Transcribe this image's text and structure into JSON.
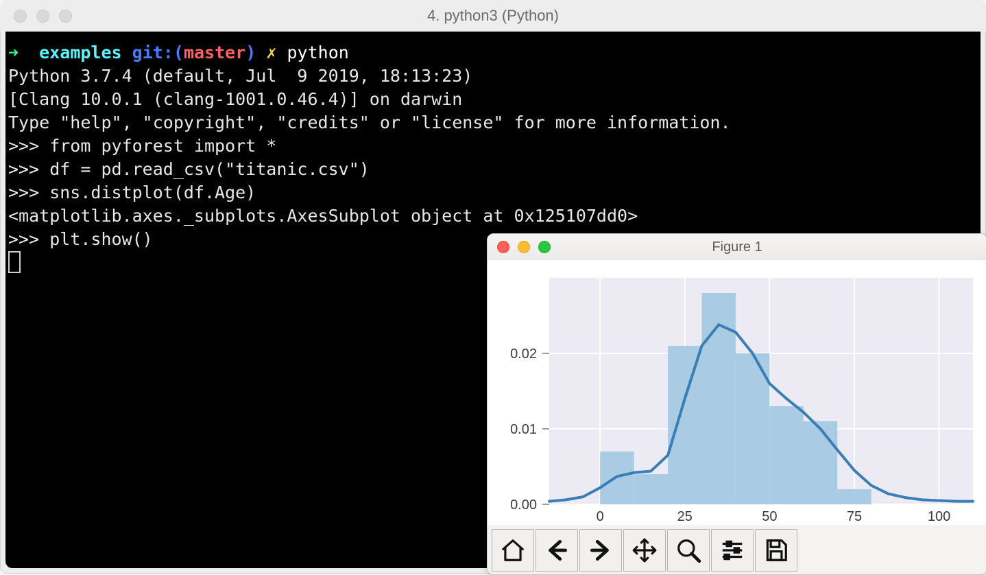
{
  "terminal": {
    "title": "4. python3 (Python)",
    "prompt": {
      "arrow": "➜",
      "dir": "examples",
      "git_label": "git:",
      "lparen": "(",
      "branch": "master",
      "rparen": ")",
      "dirty": "✗",
      "cmd": "python"
    },
    "lines": {
      "ver": "Python 3.7.4 (default, Jul  9 2019, 18:13:23)",
      "clang": "[Clang 10.0.1 (clang-1001.0.46.4)] on darwin",
      "help": "Type \"help\", \"copyright\", \"credits\" or \"license\" for more information.",
      "l1": ">>> from pyforest import *",
      "l2": ">>> df = pd.read_csv(\"titanic.csv\")",
      "l3": ">>> sns.distplot(df.Age)",
      "l4": "<matplotlib.axes._subplots.AxesSubplot object at 0x125107dd0>",
      "l5": ">>> plt.show()"
    }
  },
  "figure": {
    "title": "Figure 1",
    "toolbar": [
      "home",
      "back",
      "forward",
      "pan",
      "zoom",
      "configure",
      "save"
    ]
  },
  "chart_data": {
    "type": "histogram+kde",
    "xlabel": "",
    "ylabel": "",
    "x_ticks": [
      0,
      25,
      50,
      75,
      100
    ],
    "y_ticks": [
      0.0,
      0.01,
      0.02
    ],
    "xlim": [
      -15,
      110
    ],
    "ylim": [
      0,
      0.03
    ],
    "bins": {
      "edges": [
        -10,
        0,
        10,
        20,
        30,
        40,
        50,
        60,
        70,
        80,
        90
      ],
      "counts": [
        0.0,
        0.007,
        0.004,
        0.021,
        0.028,
        0.02,
        0.013,
        0.011,
        0.002,
        0.0
      ]
    },
    "kde": {
      "x": [
        -15,
        -10,
        -5,
        0,
        5,
        10,
        15,
        20,
        25,
        30,
        35,
        40,
        45,
        50,
        55,
        60,
        65,
        70,
        75,
        80,
        85,
        90,
        95,
        100,
        105,
        110
      ],
      "y": [
        0.0004,
        0.0006,
        0.001,
        0.0022,
        0.0037,
        0.0042,
        0.0044,
        0.0065,
        0.014,
        0.021,
        0.0238,
        0.0228,
        0.02,
        0.016,
        0.014,
        0.0122,
        0.01,
        0.0072,
        0.0045,
        0.0025,
        0.0014,
        0.0009,
        0.0006,
        0.0005,
        0.0004,
        0.0004
      ]
    }
  }
}
